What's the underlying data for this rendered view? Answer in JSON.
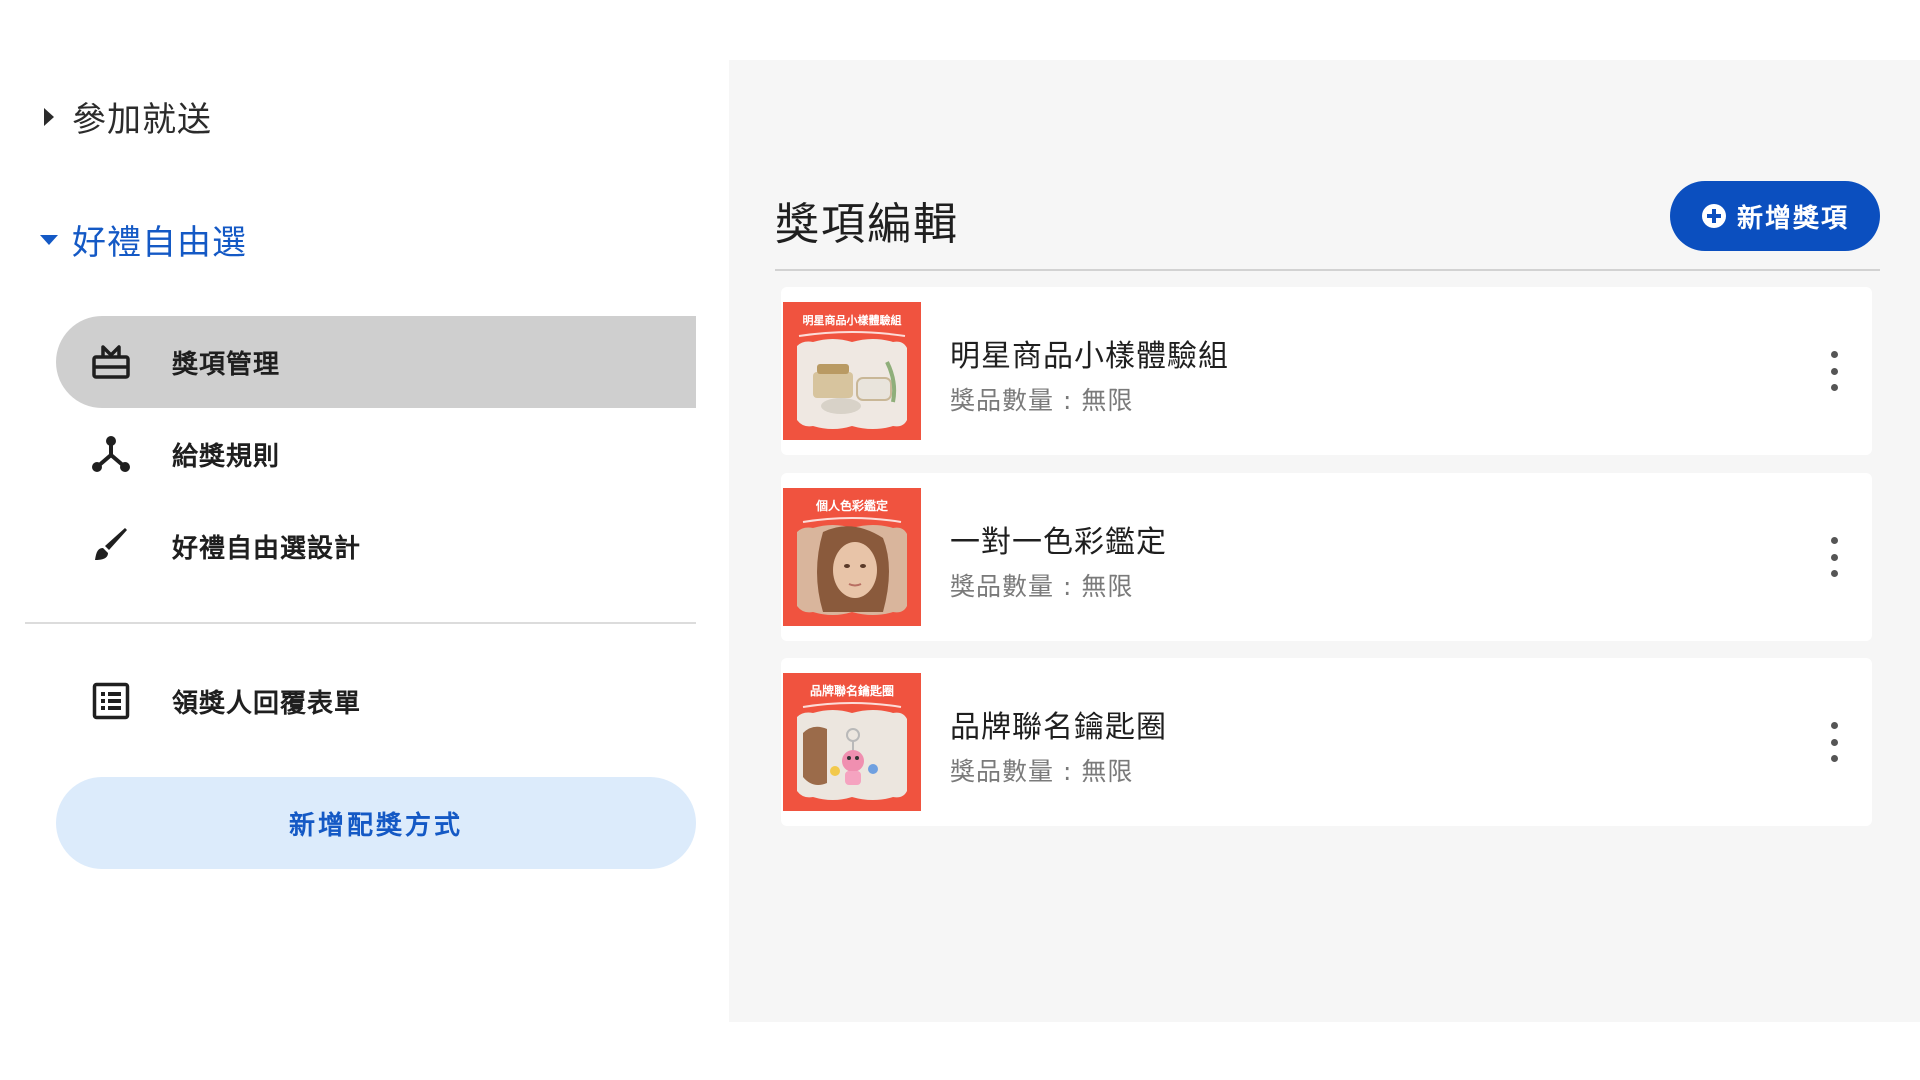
{
  "sidebar": {
    "section1": {
      "label": "參加就送",
      "state": "collapsed"
    },
    "section2": {
      "label": "好禮自由選",
      "state": "expanded"
    },
    "nav": [
      {
        "label": "獎項管理",
        "icon": "gift-icon",
        "active": true
      },
      {
        "label": "給獎規則",
        "icon": "branch-icon",
        "active": false
      },
      {
        "label": "好禮自由選設計",
        "icon": "brush-icon",
        "active": false
      },
      {
        "label": "領獎人回覆表單",
        "icon": "form-list-icon",
        "active": false
      }
    ],
    "add_method_label": "新增配獎方式"
  },
  "main": {
    "title": "獎項編輯",
    "add_prize_label": "新增獎項",
    "prizes": [
      {
        "thumb_title": "明星商品小樣體驗組",
        "name": "明星商品小樣體驗組",
        "qty": "獎品數量 : 無限"
      },
      {
        "thumb_title": "個人色彩鑑定",
        "name": "一對一色彩鑑定",
        "qty": "獎品數量 : 無限"
      },
      {
        "thumb_title": "品牌聯名鑰匙圈",
        "name": "品牌聯名鑰匙圈",
        "qty": "獎品數量 : 無限"
      }
    ]
  },
  "colors": {
    "primary": "#0b4fbf",
    "link_blue": "#1459c5",
    "active_nav_bg": "#cfcfcf",
    "secondary_button_bg": "#dcebfb",
    "thumbnail_red": "#f0533f"
  }
}
